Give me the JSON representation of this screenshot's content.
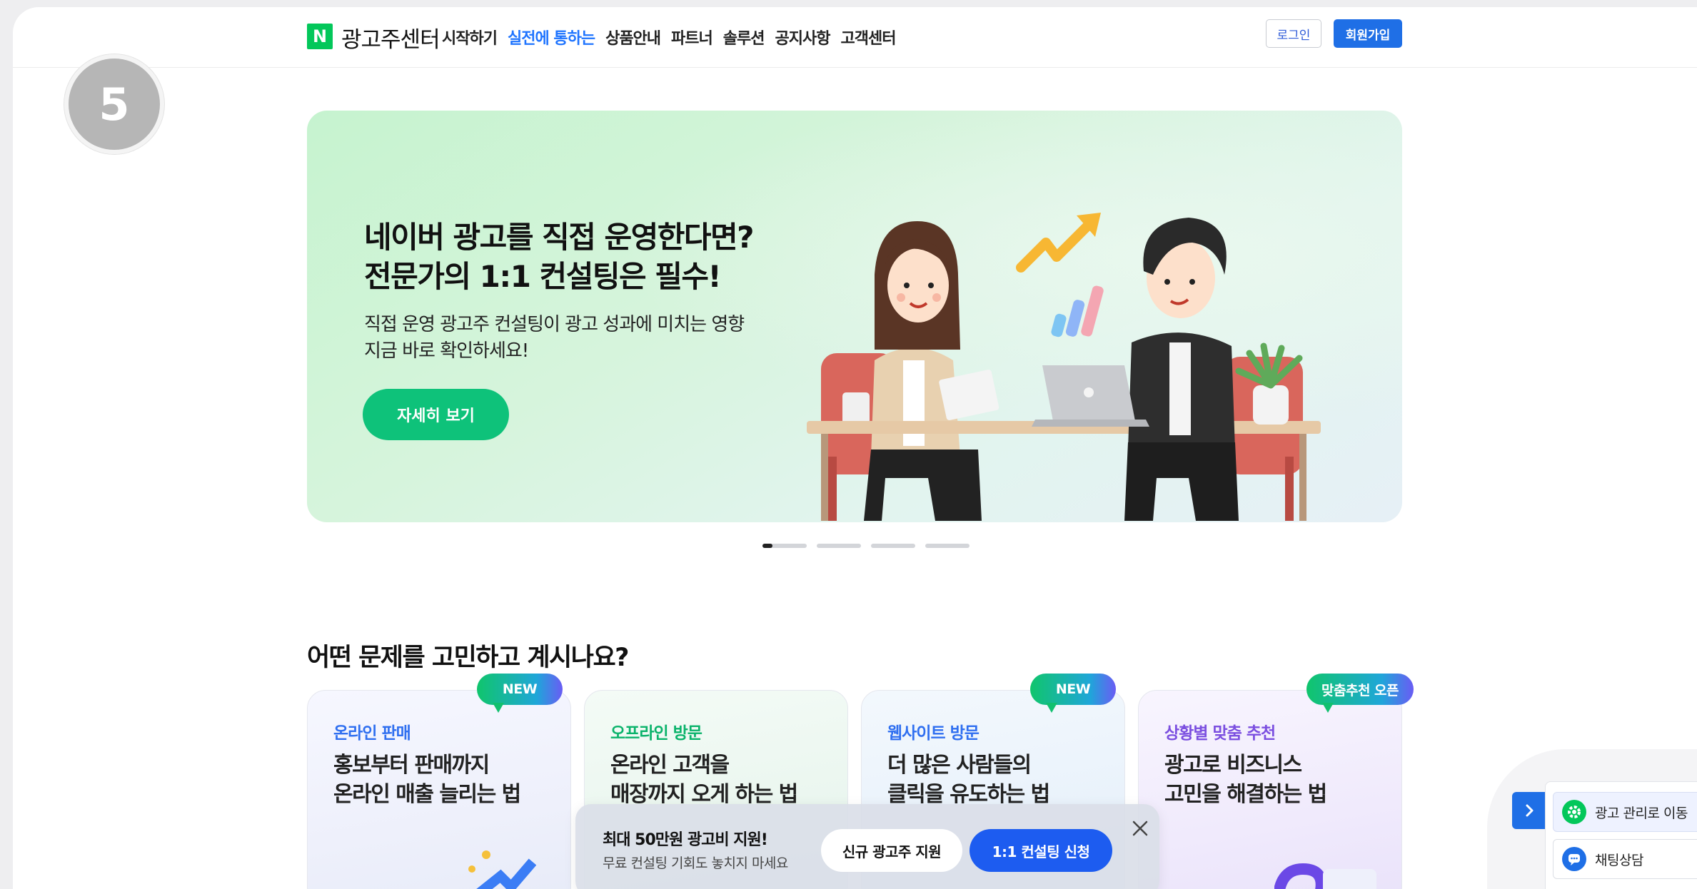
{
  "header": {
    "logo_mark": "N",
    "logo_text": "광고주센터",
    "nav": [
      {
        "label": "시작하기"
      },
      {
        "label": "실전에 통하는"
      },
      {
        "label": "상품안내"
      },
      {
        "label": "파트너"
      },
      {
        "label": "솔루션"
      },
      {
        "label": "공지사항"
      },
      {
        "label": "고객센터"
      }
    ],
    "active_nav": "실전에 통하는",
    "login_label": "로그인",
    "signup_label": "회원가입"
  },
  "step_badge": "5",
  "hero": {
    "title_line1": "네이버 광고를 직접 운영한다면?",
    "title_line2": "전문가의 1:1 컨설팅은 필수!",
    "sub_line1": "직접 운영 광고주 컨설팅이 광고 성과에 미치는 영향",
    "sub_line2": "지금 바로 확인하세요!",
    "button_label": "자세히 보기",
    "slide_count": 4,
    "active_slide": 1
  },
  "section": {
    "title": "어떤 문제를 고민하고 계시나요?",
    "cards": [
      {
        "category": "온라인 판매",
        "title_line1": "홍보부터 판매까지",
        "title_line2": "온라인 매출 늘리는 법",
        "badge": "NEW",
        "category_color": "#2f6ff0"
      },
      {
        "category": "오프라인 방문",
        "title_line1": "온라인 고객을",
        "title_line2": "매장까지 오게 하는 법",
        "badge": "",
        "category_color": "#0bb36b"
      },
      {
        "category": "웹사이트 방문",
        "title_line1": "더 많은 사람들의",
        "title_line2": "클릭을 유도하는 법",
        "badge": "NEW",
        "category_color": "#2f6ff0"
      },
      {
        "category": "상황별 맞춤 추천",
        "title_line1": "광고로 비즈니스",
        "title_line2": "고민을 해결하는 법",
        "badge": "맞춤추천 오픈",
        "category_color": "#7b4fe0"
      }
    ]
  },
  "promo": {
    "title": "최대 50만원 광고비 지원!",
    "subtitle": "무료 컨설팅 기회도 놓치지 마세요",
    "btn_new": "신규 광고주 지원",
    "btn_consult": "1:1 컨설팅 신청"
  },
  "floating": {
    "ad_manage": "광고 관리로 이동",
    "chat": "채팅상담"
  },
  "colors": {
    "brand_green": "#03c75a",
    "accent_blue": "#1f6fe6",
    "hero_button": "#0ec27a"
  },
  "icons": [
    "naver-logo-icon",
    "chevron-right-icon",
    "gear-icon",
    "chat-bubble-icon",
    "close-icon"
  ]
}
